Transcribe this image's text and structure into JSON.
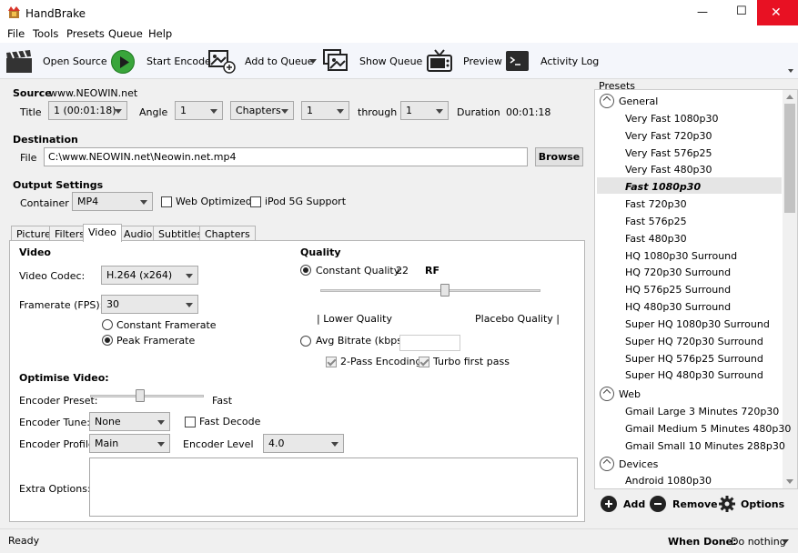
{
  "window": {
    "title": "HandBrake",
    "minimize": "—",
    "maximize": "☐",
    "close": "✕"
  },
  "menu": [
    "File",
    "Tools",
    "Presets",
    "Queue",
    "Help"
  ],
  "toolbar": {
    "open_source": "Open Source",
    "start_encode": "Start Encode",
    "add_to_queue": "Add to Queue",
    "show_queue": "Show Queue",
    "preview": "Preview",
    "activity_log": "Activity Log"
  },
  "source": {
    "label": "Source",
    "value": "www.NEOWIN.net",
    "title_label": "Title",
    "title_value": "1 (00:01:18)",
    "angle_label": "Angle",
    "angle_value": "1",
    "range_type": "Chapters",
    "range_start": "1",
    "through_label": "through",
    "range_end": "1",
    "duration_label": "Duration",
    "duration_value": "00:01:18"
  },
  "destination": {
    "label": "Destination",
    "file_label": "File",
    "file_value": "C:\\www.NEOWIN.net\\Neowin.net.mp4",
    "browse": "Browse"
  },
  "output": {
    "label": "Output Settings",
    "container_label": "Container",
    "container_value": "MP4",
    "web_optimized": "Web Optimized",
    "ipod": "iPod 5G Support"
  },
  "tabs": [
    "Picture",
    "Filters",
    "Video",
    "Audio",
    "Subtitles",
    "Chapters"
  ],
  "video": {
    "heading": "Video",
    "codec_label": "Video Codec:",
    "codec_value": "H.264 (x264)",
    "fps_label": "Framerate (FPS):",
    "fps_value": "30",
    "constant_fr": "Constant Framerate",
    "peak_fr": "Peak Framerate"
  },
  "quality": {
    "heading": "Quality",
    "cq_label": "Constant Quality:",
    "cq_value": "22",
    "cq_unit": "RF",
    "lower": "| Lower Quality",
    "placebo": "Placebo Quality |",
    "avg_label": "Avg Bitrate (kbps):",
    "two_pass": "2-Pass Encoding",
    "turbo": "Turbo first pass",
    "slider_level": 0.6
  },
  "optimise": {
    "heading": "Optimise Video:",
    "preset_label": "Encoder Preset:",
    "preset_value": "Fast",
    "preset_level": 0.45,
    "tune_label": "Encoder Tune:",
    "tune_value": "None",
    "fast_decode": "Fast Decode",
    "profile_label": "Encoder Profile:",
    "profile_value": "Main",
    "level_label": "Encoder Level",
    "level_value": "4.0",
    "extra_label": "Extra Options:"
  },
  "presets": {
    "title": "Presets",
    "groups": [
      {
        "name": "General",
        "items": [
          "Very Fast 1080p30",
          "Very Fast 720p30",
          "Very Fast 576p25",
          "Very Fast 480p30",
          "Fast 1080p30",
          "Fast 720p30",
          "Fast 576p25",
          "Fast 480p30",
          "HQ 1080p30 Surround",
          "HQ 720p30 Surround",
          "HQ 576p25 Surround",
          "HQ 480p30 Surround",
          "Super HQ 1080p30 Surround",
          "Super HQ 720p30 Surround",
          "Super HQ 576p25 Surround",
          "Super HQ 480p30 Surround"
        ]
      },
      {
        "name": "Web",
        "items": [
          "Gmail Large 3 Minutes 720p30",
          "Gmail Medium 5 Minutes 480p30",
          "Gmail Small 10 Minutes 288p30"
        ]
      },
      {
        "name": "Devices",
        "items": [
          "Android 1080p30"
        ]
      }
    ],
    "selected": "Fast 1080p30",
    "add": "Add",
    "remove": "Remove",
    "options": "Options"
  },
  "status": {
    "text": "Ready",
    "when_done_label": "When Done:",
    "when_done_value": "Do nothing"
  }
}
